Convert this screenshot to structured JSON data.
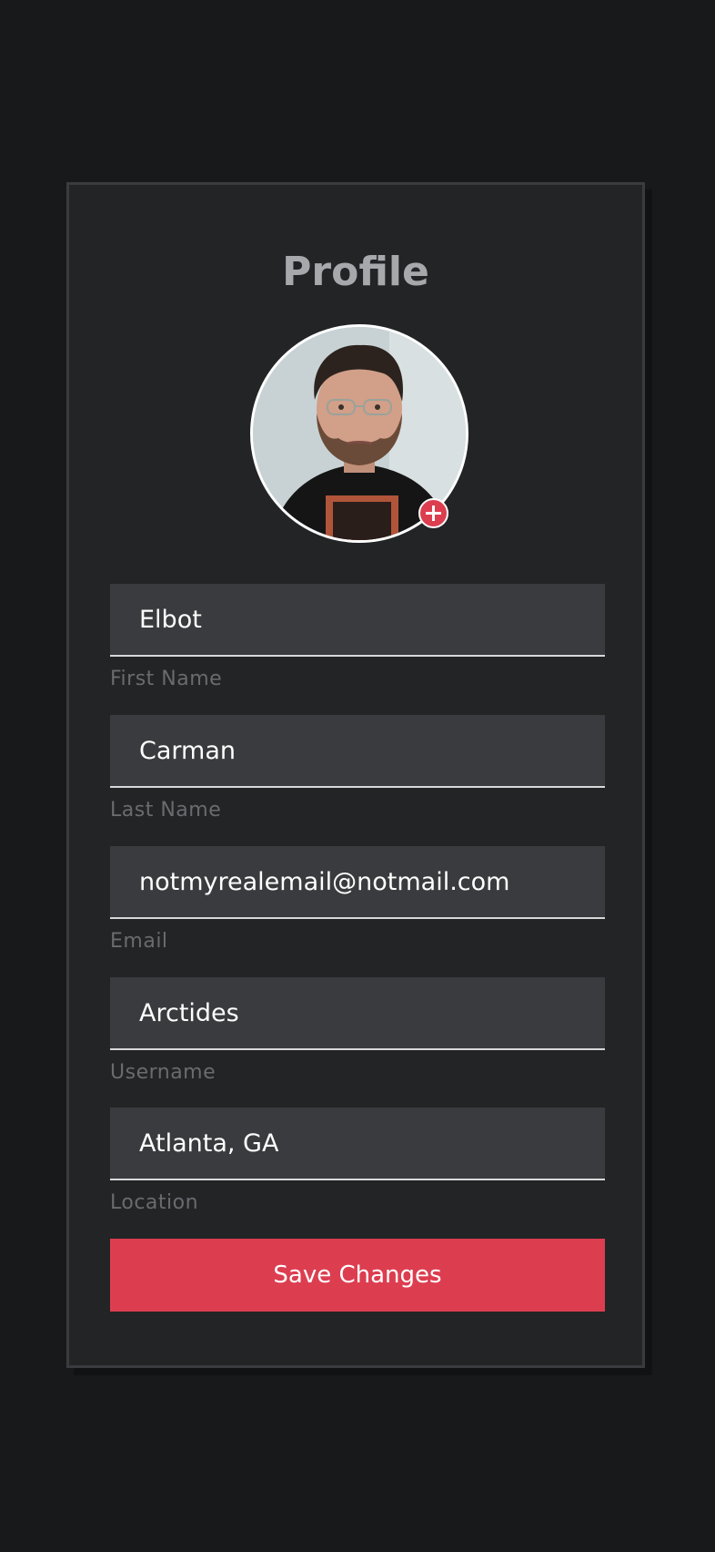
{
  "profile": {
    "title": "Profile"
  },
  "avatar": {
    "icon": "add-photo-icon"
  },
  "fields": [
    {
      "value": "Elbot",
      "label": "First Name"
    },
    {
      "value": "Carman",
      "label": "Last Name"
    },
    {
      "value": "notmyrealemail@notmail.com",
      "label": "Email"
    },
    {
      "value": "Arctides",
      "label": "Username"
    },
    {
      "value": "Atlanta, GA",
      "label": "Location"
    }
  ],
  "actions": {
    "save_label": "Save Changes"
  },
  "colors": {
    "page_background": "#18191b",
    "card_background": "#232426",
    "input_background": "#3a3b3e",
    "accent": "#dc3e50",
    "label": "#6a6b6f",
    "title": "#a7a8ac"
  }
}
